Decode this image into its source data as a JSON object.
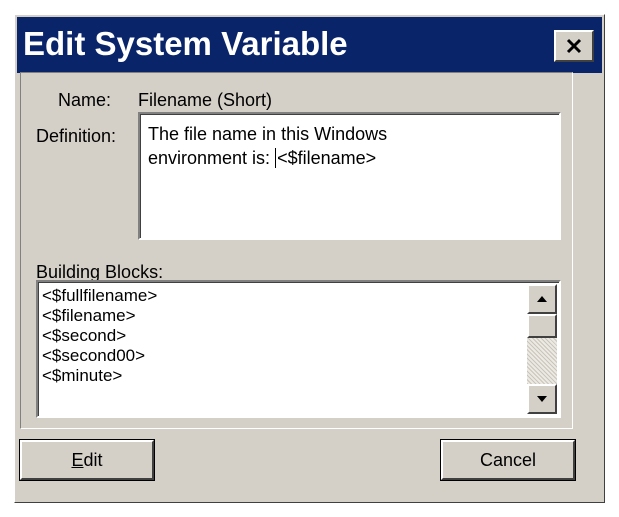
{
  "dialog": {
    "title": "Edit System Variable",
    "close_icon": "close-icon"
  },
  "name": {
    "label": "Name:",
    "value": "Filename (Short)"
  },
  "definition": {
    "label": "Definition:",
    "text_before_caret": "The file name in this Windows\nenvironment is: ",
    "text_after_caret": "<$filename>"
  },
  "building_blocks": {
    "label": "Building Blocks:",
    "items": [
      "<$fullfilename>",
      "<$filename>",
      "<$second>",
      "<$second00>",
      "<$minute>"
    ],
    "scrollbar": {
      "up_icon": "arrow-up-icon",
      "down_icon": "arrow-down-icon"
    }
  },
  "buttons": {
    "edit_mnemonic": "E",
    "edit_rest": "dit",
    "cancel": "Cancel"
  },
  "colors": {
    "titlebar": "#0a246a",
    "face": "#d4d0c8",
    "title_text": "#ffffff"
  }
}
